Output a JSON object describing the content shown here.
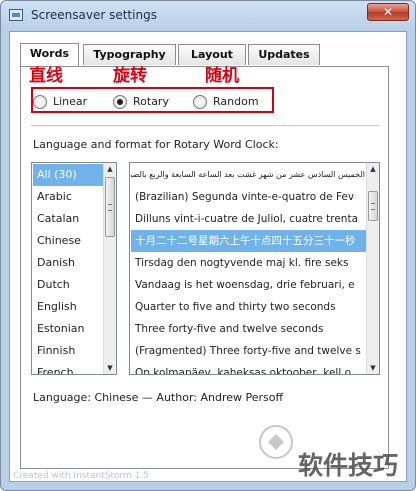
{
  "window": {
    "title": "Screensaver settings",
    "close_glyph": "✕"
  },
  "tabs": [
    {
      "label": "Words",
      "active": true
    },
    {
      "label": "Typography",
      "active": false
    },
    {
      "label": "Layout",
      "active": false
    },
    {
      "label": "Updates",
      "active": false
    }
  ],
  "annotations": {
    "linear_cn": "直线",
    "rotary_cn": "旋转",
    "random_cn": "随机"
  },
  "modes": {
    "options": [
      {
        "label": "Linear",
        "selected": false
      },
      {
        "label": "Rotary",
        "selected": true
      },
      {
        "label": "Random",
        "selected": false
      }
    ]
  },
  "section_label": "Language and format for Rotary Word Clock:",
  "languages": {
    "items": [
      "All (30)",
      "Arabic",
      "Catalan",
      "Chinese",
      "Danish",
      "Dutch",
      "English",
      "Estonian",
      "Finnish",
      "French"
    ],
    "selected_index": 0
  },
  "samples": {
    "items": [
      "الخميس السادس عشر من شهر غشت بعد الساعة السابعة والربع بالضبط بعد الحادي عشر و ",
      "(Brazilian) Segunda vinte-e-quatro de Fev",
      "Dilluns vint-i-cuatre de Juliol, cuatre trenta",
      "十月二十二号星期六上午十点四十五分三十一秒",
      "Tirsdag den nogtyvende maj kl. fire seks",
      "Vandaag is het woensdag, drie februari, e",
      "Quarter to five and thirty two seconds",
      "Three forty-five and twelve seconds",
      "(Fragmented) Three forty-five and twelve s",
      "On kolmapäev, kaheksas oktoober, kell o"
    ],
    "selected_index": 3
  },
  "status": "Language: Chinese — Author: Andrew Persoff",
  "footer": "Created with InstantStorm 1.5",
  "watermark": "软件技巧",
  "colors": {
    "highlight": "#6fb3ea",
    "annotation": "#e00010",
    "close": "#c7503c"
  }
}
